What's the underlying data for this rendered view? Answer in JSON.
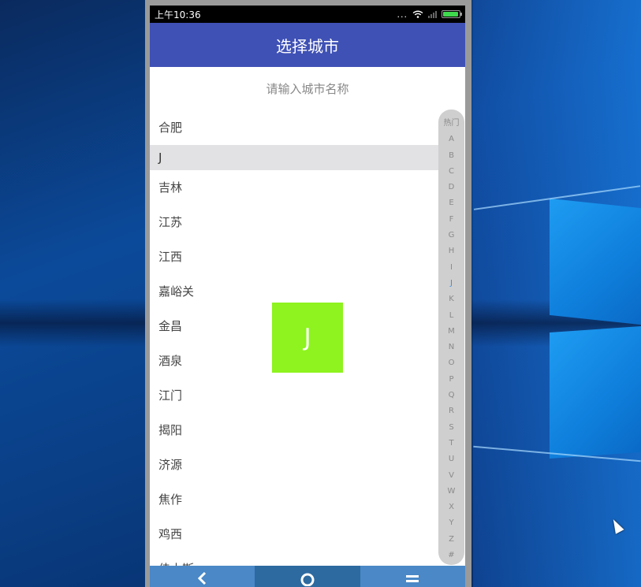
{
  "status_bar": {
    "time": "上午10:36",
    "dots": "...",
    "battery_color": "#3fd94d"
  },
  "header": {
    "title": "选择城市",
    "color": "#3f51b5"
  },
  "search": {
    "placeholder": "请输入城市名称"
  },
  "city_list": [
    {
      "type": "city",
      "label": "合肥"
    },
    {
      "type": "header",
      "label": "J"
    },
    {
      "type": "city",
      "label": "吉林"
    },
    {
      "type": "city",
      "label": "江苏"
    },
    {
      "type": "city",
      "label": "江西"
    },
    {
      "type": "city",
      "label": "嘉峪关"
    },
    {
      "type": "city",
      "label": "金昌"
    },
    {
      "type": "city",
      "label": "酒泉"
    },
    {
      "type": "city",
      "label": "江门"
    },
    {
      "type": "city",
      "label": "揭阳"
    },
    {
      "type": "city",
      "label": "济源"
    },
    {
      "type": "city",
      "label": "焦作"
    },
    {
      "type": "city",
      "label": "鸡西"
    },
    {
      "type": "city",
      "label": "佳木斯"
    }
  ],
  "index_bar": {
    "letters": [
      "热门",
      "A",
      "B",
      "C",
      "D",
      "E",
      "F",
      "G",
      "H",
      "I",
      "J",
      "K",
      "L",
      "M",
      "N",
      "O",
      "P",
      "Q",
      "R",
      "S",
      "T",
      "U",
      "V",
      "W",
      "X",
      "Y",
      "Z",
      "#"
    ],
    "active": "J",
    "active_color": "#3a8fe0"
  },
  "overlay": {
    "letter": "J",
    "color": "#8ef31e"
  },
  "bottom_nav": {
    "back_icon": "chevron-left-icon",
    "home_icon": "circle-home-icon",
    "menu_icon": "hamburger-menu-icon"
  }
}
